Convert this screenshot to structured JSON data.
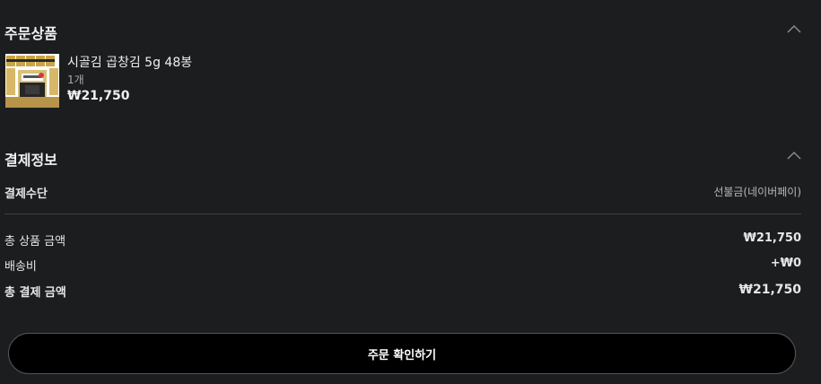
{
  "order_section": {
    "title": "주문상품",
    "collapse_icon": "chevron-up-icon"
  },
  "product": {
    "name": "시골김 곱창김 5g 48봉",
    "quantity": "1개",
    "price": "₩21,750",
    "thumbnail_icon": "product-image"
  },
  "payment_section": {
    "title": "결제정보",
    "collapse_icon": "chevron-up-icon",
    "method_label": "결제수단",
    "method_value": "선불금(네이버페이)"
  },
  "summary": {
    "subtotal_label": "총 상품 금액",
    "subtotal_value": "₩21,750",
    "shipping_label": "배송비",
    "shipping_value": "+₩0",
    "total_label": "총 결제 금액",
    "total_value": "₩21,750"
  },
  "confirm_button_label": "주문 확인하기",
  "colors": {
    "background": "#1c1d1f",
    "button_background": "#000000",
    "divider": "#3e3f42"
  }
}
